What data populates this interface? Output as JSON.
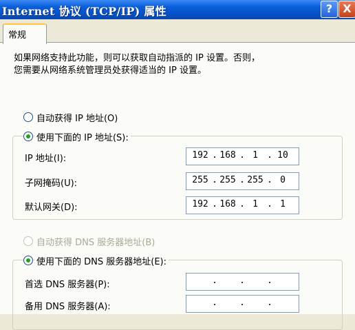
{
  "window": {
    "title": "Internet 协议 (TCP/IP) 属性",
    "help_button": "?",
    "close_button": "X"
  },
  "tabs": [
    {
      "label": "常规",
      "selected": true
    }
  ],
  "description": "如果网络支持此功能，则可以获取自动指派的 IP 设置。否则，\n您需要从网络系统管理员处获得适当的 IP 设置。",
  "ip_section": {
    "auto_option": {
      "label": "自动获得 IP 地址(O)",
      "checked": false
    },
    "manual_option": {
      "label": "使用下面的 IP 地址(S):",
      "checked": true
    },
    "fields": [
      {
        "label": "IP 地址(I):",
        "octets": [
          "192",
          "168",
          "1",
          "10"
        ]
      },
      {
        "label": "子网掩码(U):",
        "octets": [
          "255",
          "255",
          "255",
          "0"
        ]
      },
      {
        "label": "默认网关(D):",
        "octets": [
          "192",
          "168",
          "1",
          "1"
        ]
      }
    ]
  },
  "dns_section": {
    "auto_option": {
      "label": "自动获得 DNS 服务器地址(B)",
      "checked": false,
      "disabled": true
    },
    "manual_option": {
      "label": "使用下面的 DNS 服务器地址(E):",
      "checked": true
    },
    "fields": [
      {
        "label": "首选 DNS 服务器(P):",
        "octets": [
          "",
          "",
          "",
          ""
        ]
      },
      {
        "label": "备用 DNS 服务器(A):",
        "octets": [
          "",
          "",
          "",
          ""
        ]
      }
    ]
  },
  "colors": {
    "titlebar": "#0552c8",
    "dialog_bg": "#ece9d8",
    "panel_bg": "#fbfbf8",
    "tab_highlight": "#ffc83c",
    "radio_dot": "#21a121",
    "field_border": "#7f9db9"
  }
}
